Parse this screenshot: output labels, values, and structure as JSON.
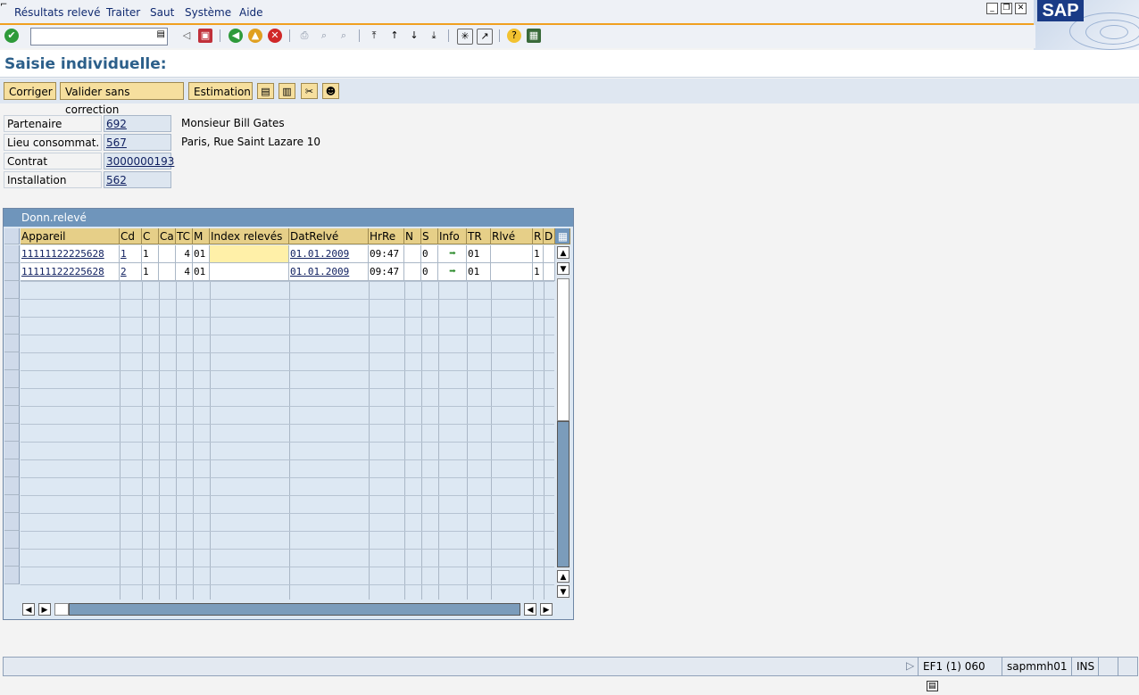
{
  "menu": {
    "items": [
      {
        "label": "Résultats relevé"
      },
      {
        "label": "Traiter"
      },
      {
        "label": "Saut"
      },
      {
        "label": "Système"
      },
      {
        "label": "Aide"
      }
    ]
  },
  "brand": {
    "logo_text": "SAP",
    "accent": "#f0a020"
  },
  "toolbar": {
    "command_value": ""
  },
  "page_title": "Saisie individuelle:",
  "app_toolbar": {
    "buttons": [
      {
        "label": "Corriger"
      },
      {
        "label": "Valider sans correction"
      },
      {
        "label": "Estimation"
      }
    ]
  },
  "header": {
    "fields": [
      {
        "label": "Partenaire",
        "value": "692",
        "text": "Monsieur Bill Gates"
      },
      {
        "label": "Lieu consommat.",
        "value": "567",
        "text": "Paris, Rue Saint Lazare  10"
      },
      {
        "label": "Contrat",
        "value": "3000000193",
        "text": ""
      },
      {
        "label": "Installation",
        "value": "562",
        "text": ""
      }
    ]
  },
  "table": {
    "title": "Donn.relevé",
    "columns": [
      "Appareil",
      "Cd",
      "C",
      "Ca",
      "TC",
      "M",
      "Index relevés",
      "DatRelvé",
      "HrRe",
      "N",
      "S",
      "Info",
      "TR",
      "Rlvé",
      "R",
      "D"
    ],
    "rows": [
      {
        "appareil": "11111122225628",
        "cd": "1",
        "c": "1",
        "ca": "",
        "tc": "4",
        "m": "01",
        "index": "",
        "date": "01.01.2009",
        "heure": "09:47",
        "n": "",
        "s": "0",
        "tr": "01",
        "rlve": "",
        "r": "1",
        "d": ""
      },
      {
        "appareil": "11111122225628",
        "cd": "2",
        "c": "1",
        "ca": "",
        "tc": "4",
        "m": "01",
        "index": "",
        "date": "01.01.2009",
        "heure": "09:47",
        "n": "",
        "s": "0",
        "tr": "01",
        "rlve": "",
        "r": "1",
        "d": ""
      }
    ]
  },
  "status": {
    "system": "EF1 (1) 060",
    "server": "sapmmh01",
    "mode": "INS"
  }
}
